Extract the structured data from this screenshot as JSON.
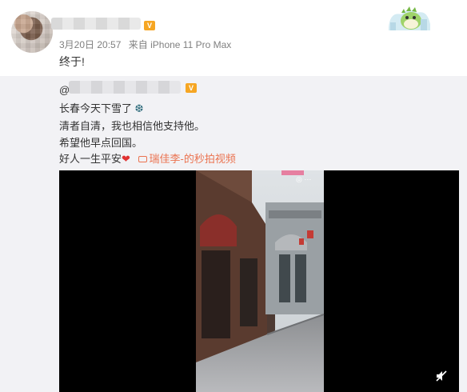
{
  "post": {
    "meta": {
      "date": "3月20日 20:57",
      "source_prefix": "来自",
      "source_device": "iPhone 11 Pro Max"
    },
    "text": "终于!"
  },
  "repost": {
    "at_symbol": "@",
    "lines": [
      "长春今天下雪了",
      "清者自清，我也相信他支持他。",
      "希望他早点回国。",
      "好人一生平安"
    ],
    "video_link_label": "瑞佳李-的秒拍视频"
  },
  "video": {
    "watermark": "",
    "icons": [
      "mute-icon"
    ]
  },
  "icons": {
    "snowflake": "❆",
    "heart": "❤"
  },
  "colors": {
    "link": "#eb7350",
    "repost_bg": "#f2f2f5",
    "meta_text": "#808080"
  }
}
